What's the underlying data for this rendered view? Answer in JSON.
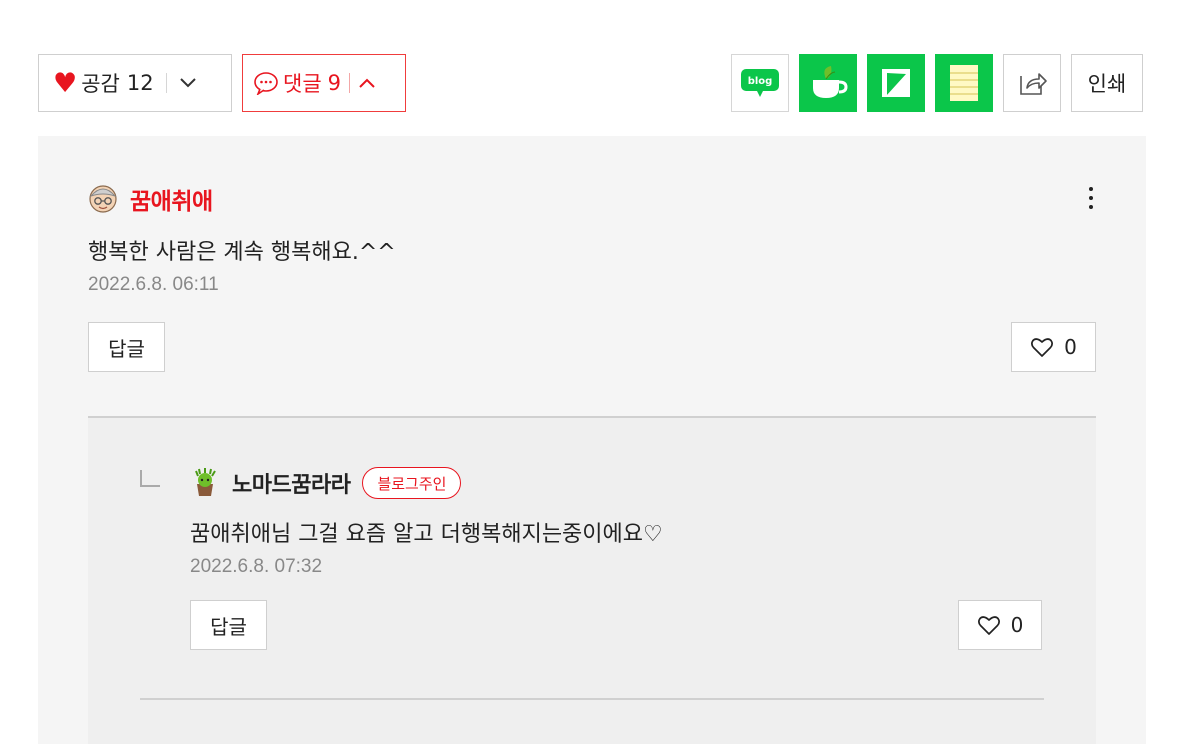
{
  "toolbar": {
    "like": {
      "heart_icon": "heart-icon",
      "label": "공감",
      "count": "12"
    },
    "comments": {
      "label": "댓글",
      "count": "9"
    },
    "share_buttons": [
      "blog-icon",
      "cafe-icon",
      "keep-icon",
      "memo-icon",
      "share-icon"
    ],
    "print_label": "인쇄"
  },
  "comments": [
    {
      "author": "꿈애취애",
      "text": "행복한 사람은 계속 행복해요.^^",
      "date": "2022.6.8. 06:11",
      "reply_label": "답글",
      "likes": "0"
    }
  ],
  "replies": [
    {
      "author": "노마드꿈라라",
      "badge": "블로그주인",
      "text": "꿈애취애님 그걸 요즘 알고 더행복해지는중이에요♡",
      "date": "2022.6.8. 07:32",
      "reply_label": "답글",
      "likes": "0"
    }
  ],
  "colors": {
    "accent": "#e8151f",
    "naver_green": "#0bc64a",
    "panel_bg": "#f5f5f5"
  }
}
